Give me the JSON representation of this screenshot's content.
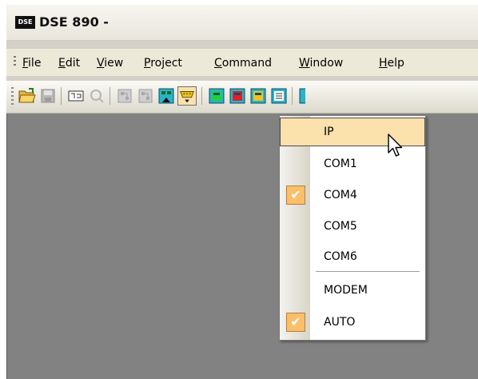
{
  "window": {
    "logo_text": "DSE",
    "title": "DSE 890 -"
  },
  "menubar": {
    "items": [
      {
        "underline": "F",
        "rest": "ile"
      },
      {
        "underline": "E",
        "rest": "dit"
      },
      {
        "underline": "V",
        "rest": "iew"
      },
      {
        "underline": "P",
        "rest": "roject"
      },
      {
        "underline": "C",
        "rest": "ommand"
      },
      {
        "underline": "W",
        "rest": "indow"
      },
      {
        "underline": "H",
        "rest": "elp"
      }
    ]
  },
  "toolbar": {
    "buttons": [
      "open-folder-icon",
      "save-icon",
      "connect-icon",
      "search-icon",
      "network-icon-a",
      "network-icon-b",
      "network-tree-icon",
      "serial-port-icon",
      "monitor-green-icon",
      "monitor-red-icon",
      "monitor-yellow-icon",
      "monitor-list-icon",
      "monitor-partial-icon"
    ]
  },
  "port_menu": {
    "items": [
      {
        "label": "IP",
        "highlighted": true,
        "checked": false
      },
      {
        "label": "COM1",
        "highlighted": false,
        "checked": false
      },
      {
        "label": "COM4",
        "highlighted": false,
        "checked": true
      },
      {
        "label": "COM5",
        "highlighted": false,
        "checked": false
      },
      {
        "label": "COM6",
        "highlighted": false,
        "checked": false
      },
      {
        "label": "MODEM",
        "highlighted": false,
        "checked": false
      },
      {
        "label": "AUTO",
        "highlighted": false,
        "checked": true
      }
    ],
    "check_glyph": "✔"
  },
  "colors": {
    "menu_highlight": "#fbe1ac",
    "check_bg": "#fbbf6a",
    "client_bg": "#828282"
  }
}
